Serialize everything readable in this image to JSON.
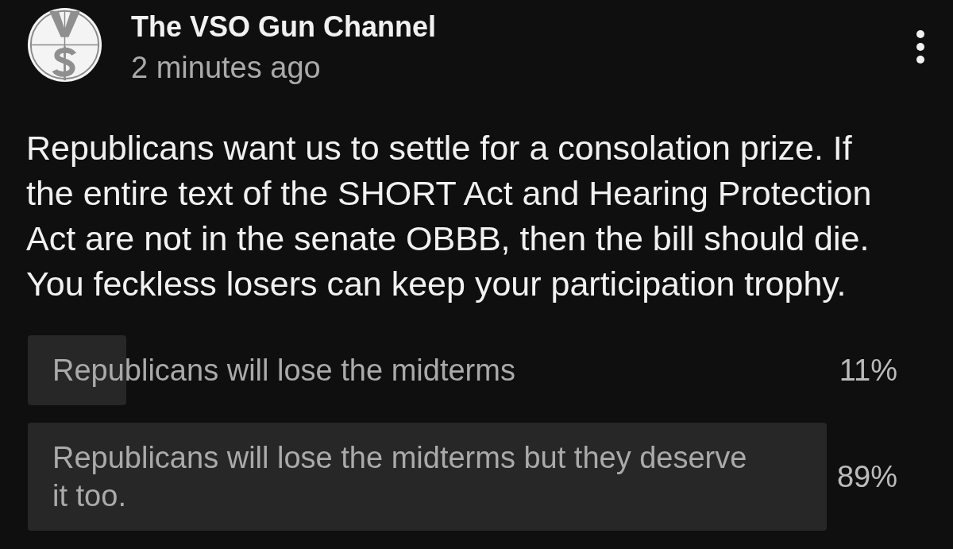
{
  "post": {
    "channel_name": "The VSO Gun Channel",
    "time": "2 minutes ago",
    "text": "Republicans want us to settle for a consolation prize. If the entire text of the SHORT Act and Hearing Protection Act are not in the senate OBBB, then the bill should die. You feckless losers can keep your participation trophy.",
    "poll": {
      "options": [
        {
          "label": "Republicans will lose the midterms",
          "level": 0.11,
          "percent": "11%"
        },
        {
          "label": "Republicans will lose the midterms but they deserve it too.",
          "level": 0.89,
          "percent": "89%"
        }
      ]
    }
  }
}
